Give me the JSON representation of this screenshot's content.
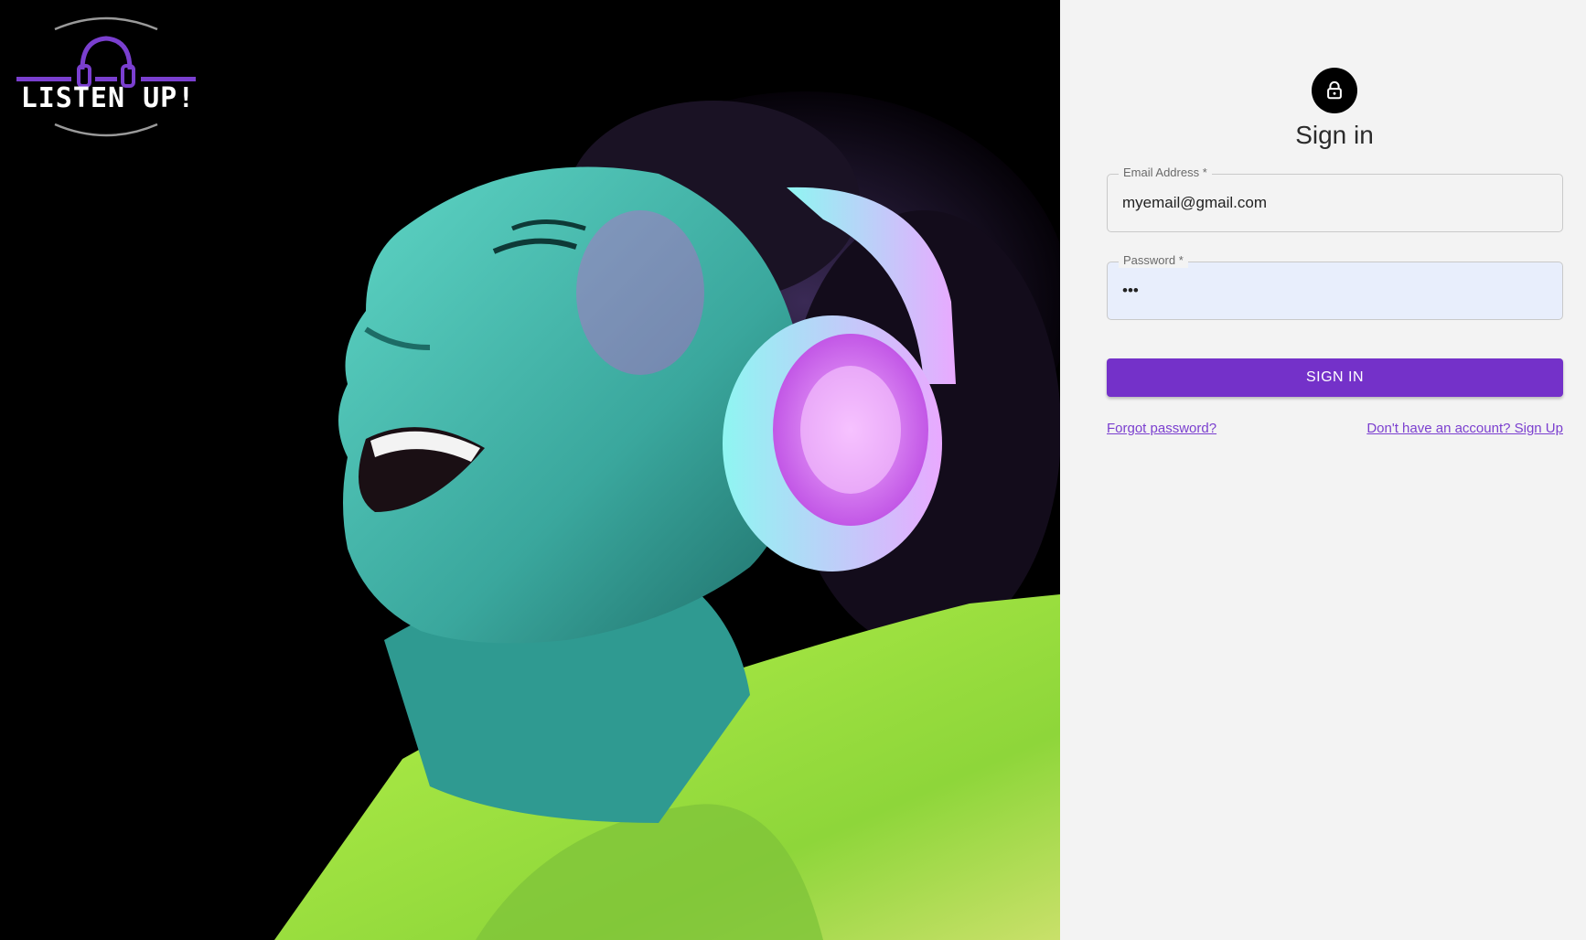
{
  "brand": {
    "logo_text": "LISTEN UP!",
    "accent_color": "#7431c9"
  },
  "hero": {
    "image_description_icon": "hero-photo"
  },
  "signin": {
    "lock_icon": "lock-icon",
    "title": "Sign in",
    "email": {
      "label": "Email Address *",
      "value": "myemail@gmail.com"
    },
    "password": {
      "label": "Password *",
      "value": "•••"
    },
    "submit_label": "SIGN IN",
    "forgot_link": "Forgot password?",
    "signup_link": "Don't have an account? Sign Up"
  }
}
